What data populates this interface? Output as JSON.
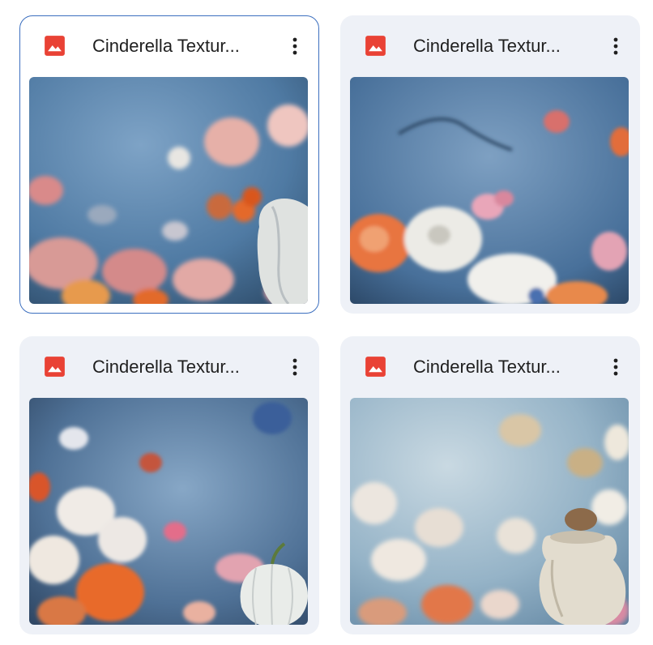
{
  "files": [
    {
      "title": "Cinderella Textur...",
      "icon": "image-file-icon",
      "selected": true
    },
    {
      "title": "Cinderella Textur...",
      "icon": "image-file-icon",
      "selected": false
    },
    {
      "title": "Cinderella Textur...",
      "icon": "image-file-icon",
      "selected": false
    },
    {
      "title": "Cinderella Textur...",
      "icon": "image-file-icon",
      "selected": false
    }
  ],
  "more_icon": "more-vert-icon",
  "colors": {
    "card_bg": "#eef1f7",
    "selected_border": "#3c6fbf",
    "image_icon": "#e94235",
    "text": "#1f1f1f"
  }
}
